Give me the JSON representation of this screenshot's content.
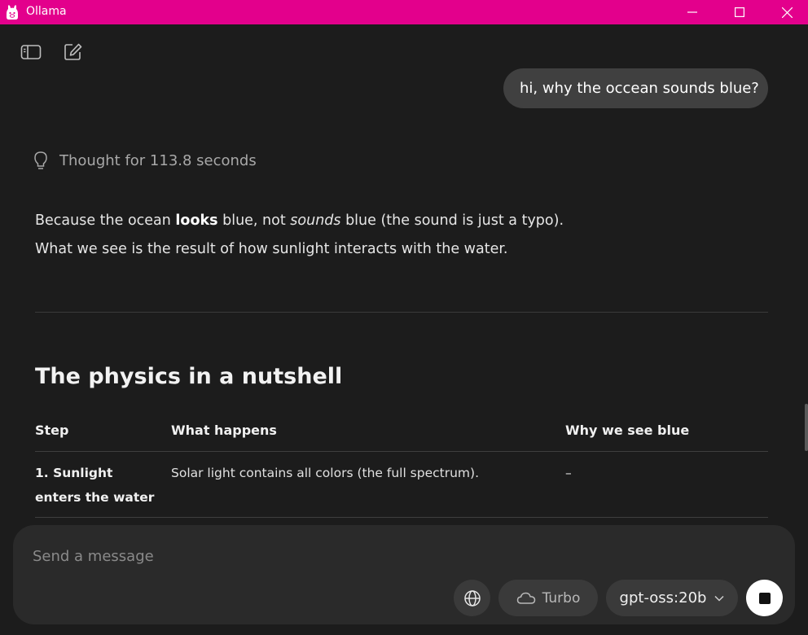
{
  "window": {
    "title": "Ollama",
    "accent_color": "#e3008c",
    "controls": {
      "minimize_icon": "minimize-icon",
      "maximize_icon": "maximize-icon",
      "close_icon": "close-icon"
    }
  },
  "toolbar": {
    "sidebar_icon": "sidebar-toggle-icon",
    "new_chat_icon": "compose-icon"
  },
  "conversation": {
    "user_message": "hi, why the occean sounds blue?",
    "thought": {
      "icon": "lightbulb-icon",
      "text": "Thought for 113.8 seconds"
    },
    "answer": {
      "p1": {
        "a": "Because the ocean ",
        "b_bold": "looks",
        "c": " blue, not ",
        "d_italic": "sounds",
        "e": " blue (the sound is just a typo)."
      },
      "p2": "What we see is the result of how sunlight interacts with the water.",
      "section_heading": "The physics in a nutshell",
      "table": {
        "headers": [
          "Step",
          "What happens",
          "Why we see blue"
        ],
        "rows": [
          [
            "1. Sunlight enters the water",
            "Solar light contains all colors (the full spectrum).",
            "–"
          ]
        ]
      }
    }
  },
  "composer": {
    "placeholder": "Send a message",
    "value": "",
    "web_search_icon": "globe-icon",
    "turbo_label": "Turbo",
    "turbo_icon": "cloud-icon",
    "model": "gpt-oss:20b",
    "model_icon": "chevron-down-icon",
    "stop_icon": "stop-icon"
  }
}
